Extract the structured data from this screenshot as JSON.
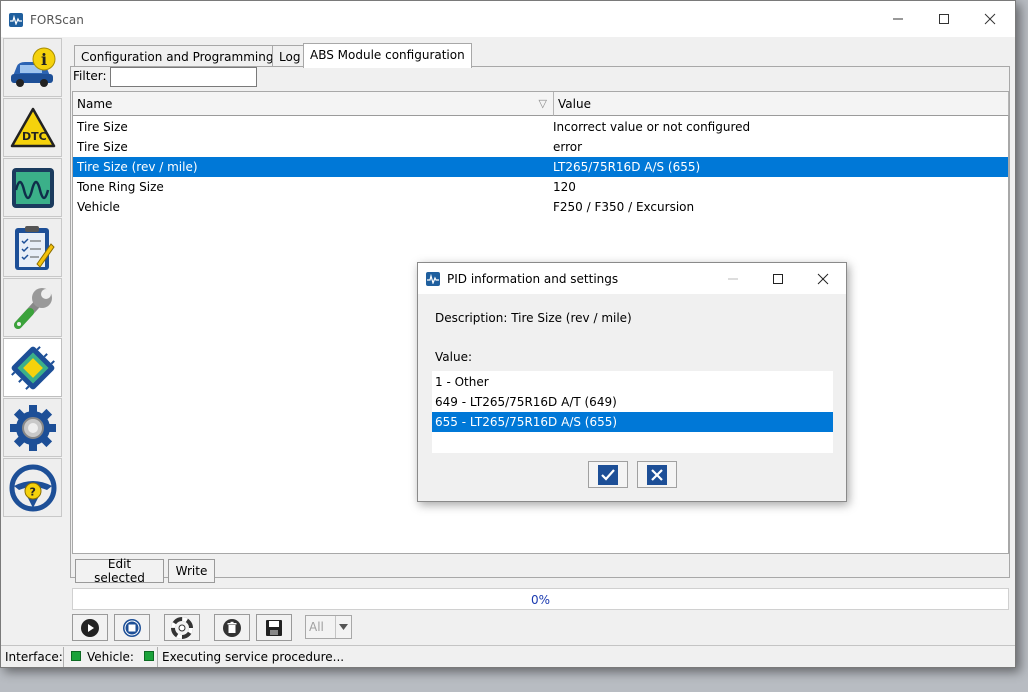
{
  "window": {
    "title": "FORScan",
    "minimize_glyph": "—",
    "maximize_glyph": "☐",
    "close_glyph": "✕"
  },
  "sidebar": {
    "items": [
      {
        "name": "vehicle-info",
        "icon": "car-info-icon"
      },
      {
        "name": "dtc",
        "icon": "dtc-warning-icon",
        "label": "DTC"
      },
      {
        "name": "oscilloscope",
        "icon": "oscilloscope-icon"
      },
      {
        "name": "tests",
        "icon": "checklist-icon"
      },
      {
        "name": "service",
        "icon": "wrench-icon"
      },
      {
        "name": "configuration",
        "icon": "chip-icon",
        "active": true
      },
      {
        "name": "settings",
        "icon": "gear-icon"
      },
      {
        "name": "help",
        "icon": "steering-help-icon",
        "label": "?"
      }
    ]
  },
  "tabs": [
    {
      "label": "Configuration and Programming"
    },
    {
      "label": "Log"
    },
    {
      "label": "ABS Module configuration",
      "active": true
    }
  ],
  "filter": {
    "label": "Filter:",
    "value": ""
  },
  "grid": {
    "columns": [
      "Name",
      "Value"
    ],
    "sort_glyph": "▽",
    "rows": [
      {
        "name": "Tire Size",
        "value": "Incorrect value or not configured"
      },
      {
        "name": "Tire Size",
        "value": "error"
      },
      {
        "name": "Tire Size (rev / mile)",
        "value": "LT265/75R16D A/S (655)",
        "selected": true
      },
      {
        "name": "Tone Ring Size",
        "value": "120"
      },
      {
        "name": "Vehicle",
        "value": "F250 / F350 / Excursion"
      }
    ]
  },
  "actions": {
    "edit_selected": "Edit selected",
    "write": "Write"
  },
  "progress": {
    "text": "0%",
    "fraction": 0
  },
  "toolbar": {
    "buttons": [
      "play-icon",
      "stop-icon",
      "lifebuoy-icon",
      "trash-icon",
      "save-icon"
    ],
    "scope_select": "All",
    "scope_arrow": "▼"
  },
  "status": {
    "interface_label": "Interface:",
    "vehicle_label": "Vehicle:",
    "message": "Executing service procedure..."
  },
  "dialog": {
    "title": "PID information and settings",
    "description": "Description: Tire Size (rev / mile)",
    "value_label": "Value:",
    "options": [
      {
        "label": "1 - Other"
      },
      {
        "label": "649 - LT265/75R16D A/T (649)"
      },
      {
        "label": "655 - LT265/75R16D A/S (655)",
        "selected": true
      }
    ],
    "minimize_glyph": "—",
    "maximize_glyph": "☐",
    "close_glyph": "✕"
  },
  "colors": {
    "selection": "#0078d7",
    "status_led": "#1aa23a",
    "progress_text": "#1a3ab0"
  }
}
